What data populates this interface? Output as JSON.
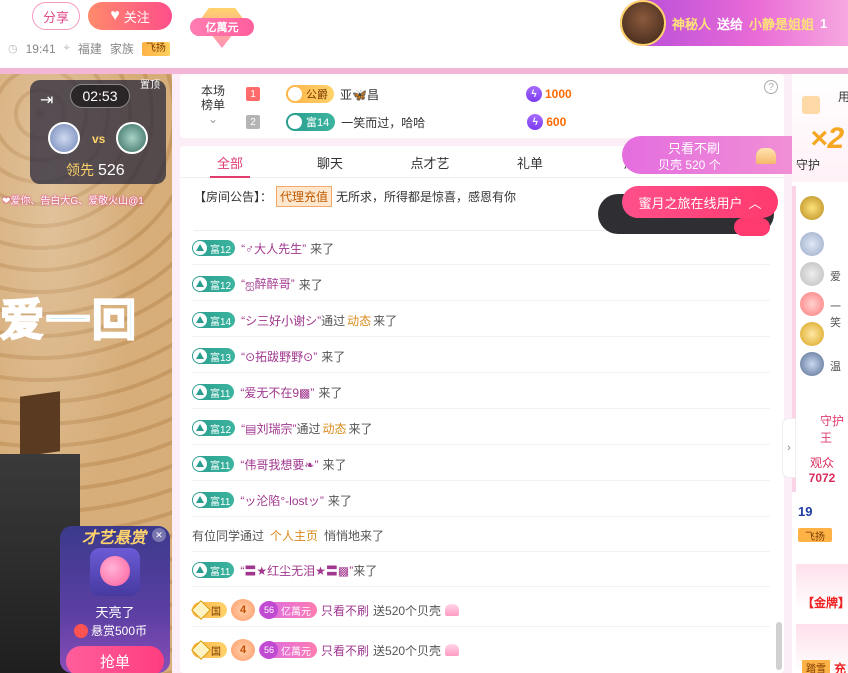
{
  "header": {
    "share_label": "分享",
    "follow_label": "关注",
    "rich_badge": "亿萬元",
    "time": "19:41",
    "location": "福建",
    "family_label": "家族",
    "family_tag": "飞扬"
  },
  "gift_banner": {
    "sender": "神秘人",
    "action": "送给",
    "receiver": "小静是姐姐",
    "tail": "1"
  },
  "pk": {
    "top_tag": "置顶",
    "timer": "02:53",
    "vs": "vs",
    "lead_label": "领先",
    "lead_value": "526",
    "names": "❤爱你、告白大G、爱敬火山@1"
  },
  "video": {
    "overlay_text": "爱一回"
  },
  "reward": {
    "title": "才艺悬赏",
    "item_name": "天亮了",
    "amount": "悬赏500币",
    "grab_label": "抢单"
  },
  "rank": {
    "label": "本场榜单",
    "rows": [
      {
        "rank": "1",
        "badge": "公爵",
        "name": "亚🦋昌",
        "score": "1000"
      },
      {
        "rank": "2",
        "badge": "富14",
        "name": "一笑而过，哈哈",
        "score": "600"
      }
    ],
    "help": "?"
  },
  "tabs": [
    "全部",
    "聊天",
    "点才艺",
    "礼单",
    "活"
  ],
  "notice": {
    "prefix": "【房间公告】：",
    "agent": "代理充值",
    "text": "无所求，所得都是惊喜，感恩有你"
  },
  "messages": [
    {
      "level": "富12",
      "user": "“♂大人先生”",
      "via": "",
      "link": "",
      "tail": "来了"
    },
    {
      "level": "富12",
      "user": "“ஐ醉醉哥”",
      "via": "",
      "link": "",
      "tail": "来了"
    },
    {
      "level": "富14",
      "user": "“シ三好小谢シ”",
      "via": "通过",
      "link": "动态",
      "tail": "来了"
    },
    {
      "level": "富13",
      "user": "“⊙拓跋野野⊙”",
      "via": "",
      "link": "",
      "tail": "来了"
    },
    {
      "level": "富11",
      "user": "“爱无不在9▩”",
      "via": "",
      "link": "",
      "tail": "来了"
    },
    {
      "level": "富12",
      "user": "“▤刘瑞宗”",
      "via": "通过",
      "link": "动态",
      "tail": "来了"
    },
    {
      "level": "富11",
      "user": "“伟哥我想要❧”",
      "via": "",
      "link": "",
      "tail": "来了"
    },
    {
      "level": "富11",
      "user": "“ッ沦陷°-lostッ”",
      "via": "",
      "link": "",
      "tail": "来了"
    }
  ],
  "system_msg": {
    "prefix": "有位同学通过",
    "link": "个人主页",
    "tail": "悄悄地来了"
  },
  "last_enter": {
    "level": "富11",
    "user": "“〓★红尘无泪★〓▩”",
    "tail": "来了"
  },
  "gift_msgs": [
    {
      "guo": "国",
      "lvl": "4",
      "rich_n": "56",
      "rich": "亿萬元",
      "user": "只看不刷",
      "text": "送520个贝壳"
    },
    {
      "guo": "国",
      "lvl": "4",
      "rich_n": "56",
      "rich": "亿萬元",
      "user": "只看不刷",
      "text": "送520个贝壳"
    }
  ],
  "float_card": {
    "line1": "只看不刷",
    "line2": "贝壳 520 个"
  },
  "online_btn": {
    "label": "蜜月之旅在线用户",
    "icon": "chevron-up-icon"
  },
  "right": {
    "use_label": "用",
    "multiplier": "×2",
    "guard_label": "守护",
    "guard_list_label": "守护王",
    "viewers_label": "观众",
    "viewers_count": "7072",
    "row_a": "19",
    "row_b_tag": "飞扬",
    "row_c_label": "【金牌】",
    "row_d_tag": "踏雪",
    "row_d_name": "充",
    "list_names": [
      "爱",
      "一笑",
      "温"
    ]
  },
  "colors": {
    "accent": "#e23c6f",
    "pink_bg": "#fbeef6",
    "level_green": "#2a9d8f",
    "link_gold": "#d98a1b"
  }
}
